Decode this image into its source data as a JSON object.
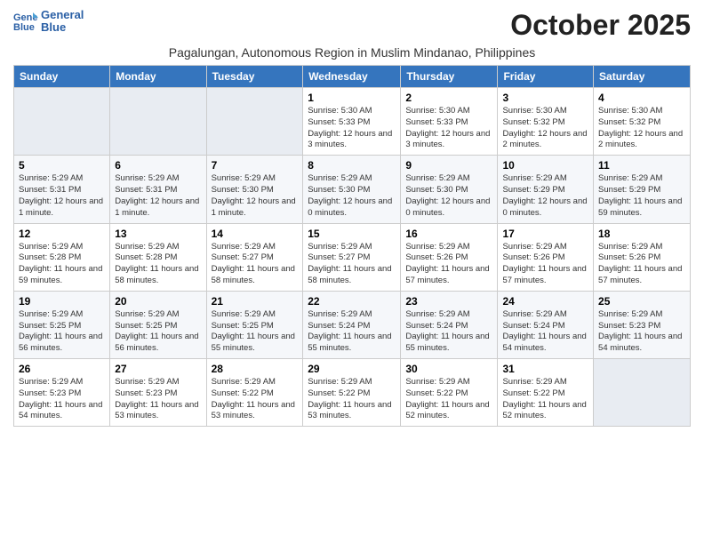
{
  "header": {
    "logo_line1": "General",
    "logo_line2": "Blue",
    "month_title": "October 2025",
    "subtitle": "Pagalungan, Autonomous Region in Muslim Mindanao, Philippines"
  },
  "days_of_week": [
    "Sunday",
    "Monday",
    "Tuesday",
    "Wednesday",
    "Thursday",
    "Friday",
    "Saturday"
  ],
  "weeks": [
    [
      {
        "day": "",
        "info": ""
      },
      {
        "day": "",
        "info": ""
      },
      {
        "day": "",
        "info": ""
      },
      {
        "day": "1",
        "info": "Sunrise: 5:30 AM\nSunset: 5:33 PM\nDaylight: 12 hours and 3 minutes."
      },
      {
        "day": "2",
        "info": "Sunrise: 5:30 AM\nSunset: 5:33 PM\nDaylight: 12 hours and 3 minutes."
      },
      {
        "day": "3",
        "info": "Sunrise: 5:30 AM\nSunset: 5:32 PM\nDaylight: 12 hours and 2 minutes."
      },
      {
        "day": "4",
        "info": "Sunrise: 5:30 AM\nSunset: 5:32 PM\nDaylight: 12 hours and 2 minutes."
      }
    ],
    [
      {
        "day": "5",
        "info": "Sunrise: 5:29 AM\nSunset: 5:31 PM\nDaylight: 12 hours and 1 minute."
      },
      {
        "day": "6",
        "info": "Sunrise: 5:29 AM\nSunset: 5:31 PM\nDaylight: 12 hours and 1 minute."
      },
      {
        "day": "7",
        "info": "Sunrise: 5:29 AM\nSunset: 5:30 PM\nDaylight: 12 hours and 1 minute."
      },
      {
        "day": "8",
        "info": "Sunrise: 5:29 AM\nSunset: 5:30 PM\nDaylight: 12 hours and 0 minutes."
      },
      {
        "day": "9",
        "info": "Sunrise: 5:29 AM\nSunset: 5:30 PM\nDaylight: 12 hours and 0 minutes."
      },
      {
        "day": "10",
        "info": "Sunrise: 5:29 AM\nSunset: 5:29 PM\nDaylight: 12 hours and 0 minutes."
      },
      {
        "day": "11",
        "info": "Sunrise: 5:29 AM\nSunset: 5:29 PM\nDaylight: 11 hours and 59 minutes."
      }
    ],
    [
      {
        "day": "12",
        "info": "Sunrise: 5:29 AM\nSunset: 5:28 PM\nDaylight: 11 hours and 59 minutes."
      },
      {
        "day": "13",
        "info": "Sunrise: 5:29 AM\nSunset: 5:28 PM\nDaylight: 11 hours and 58 minutes."
      },
      {
        "day": "14",
        "info": "Sunrise: 5:29 AM\nSunset: 5:27 PM\nDaylight: 11 hours and 58 minutes."
      },
      {
        "day": "15",
        "info": "Sunrise: 5:29 AM\nSunset: 5:27 PM\nDaylight: 11 hours and 58 minutes."
      },
      {
        "day": "16",
        "info": "Sunrise: 5:29 AM\nSunset: 5:26 PM\nDaylight: 11 hours and 57 minutes."
      },
      {
        "day": "17",
        "info": "Sunrise: 5:29 AM\nSunset: 5:26 PM\nDaylight: 11 hours and 57 minutes."
      },
      {
        "day": "18",
        "info": "Sunrise: 5:29 AM\nSunset: 5:26 PM\nDaylight: 11 hours and 57 minutes."
      }
    ],
    [
      {
        "day": "19",
        "info": "Sunrise: 5:29 AM\nSunset: 5:25 PM\nDaylight: 11 hours and 56 minutes."
      },
      {
        "day": "20",
        "info": "Sunrise: 5:29 AM\nSunset: 5:25 PM\nDaylight: 11 hours and 56 minutes."
      },
      {
        "day": "21",
        "info": "Sunrise: 5:29 AM\nSunset: 5:25 PM\nDaylight: 11 hours and 55 minutes."
      },
      {
        "day": "22",
        "info": "Sunrise: 5:29 AM\nSunset: 5:24 PM\nDaylight: 11 hours and 55 minutes."
      },
      {
        "day": "23",
        "info": "Sunrise: 5:29 AM\nSunset: 5:24 PM\nDaylight: 11 hours and 55 minutes."
      },
      {
        "day": "24",
        "info": "Sunrise: 5:29 AM\nSunset: 5:24 PM\nDaylight: 11 hours and 54 minutes."
      },
      {
        "day": "25",
        "info": "Sunrise: 5:29 AM\nSunset: 5:23 PM\nDaylight: 11 hours and 54 minutes."
      }
    ],
    [
      {
        "day": "26",
        "info": "Sunrise: 5:29 AM\nSunset: 5:23 PM\nDaylight: 11 hours and 54 minutes."
      },
      {
        "day": "27",
        "info": "Sunrise: 5:29 AM\nSunset: 5:23 PM\nDaylight: 11 hours and 53 minutes."
      },
      {
        "day": "28",
        "info": "Sunrise: 5:29 AM\nSunset: 5:22 PM\nDaylight: 11 hours and 53 minutes."
      },
      {
        "day": "29",
        "info": "Sunrise: 5:29 AM\nSunset: 5:22 PM\nDaylight: 11 hours and 53 minutes."
      },
      {
        "day": "30",
        "info": "Sunrise: 5:29 AM\nSunset: 5:22 PM\nDaylight: 11 hours and 52 minutes."
      },
      {
        "day": "31",
        "info": "Sunrise: 5:29 AM\nSunset: 5:22 PM\nDaylight: 11 hours and 52 minutes."
      },
      {
        "day": "",
        "info": ""
      }
    ]
  ]
}
